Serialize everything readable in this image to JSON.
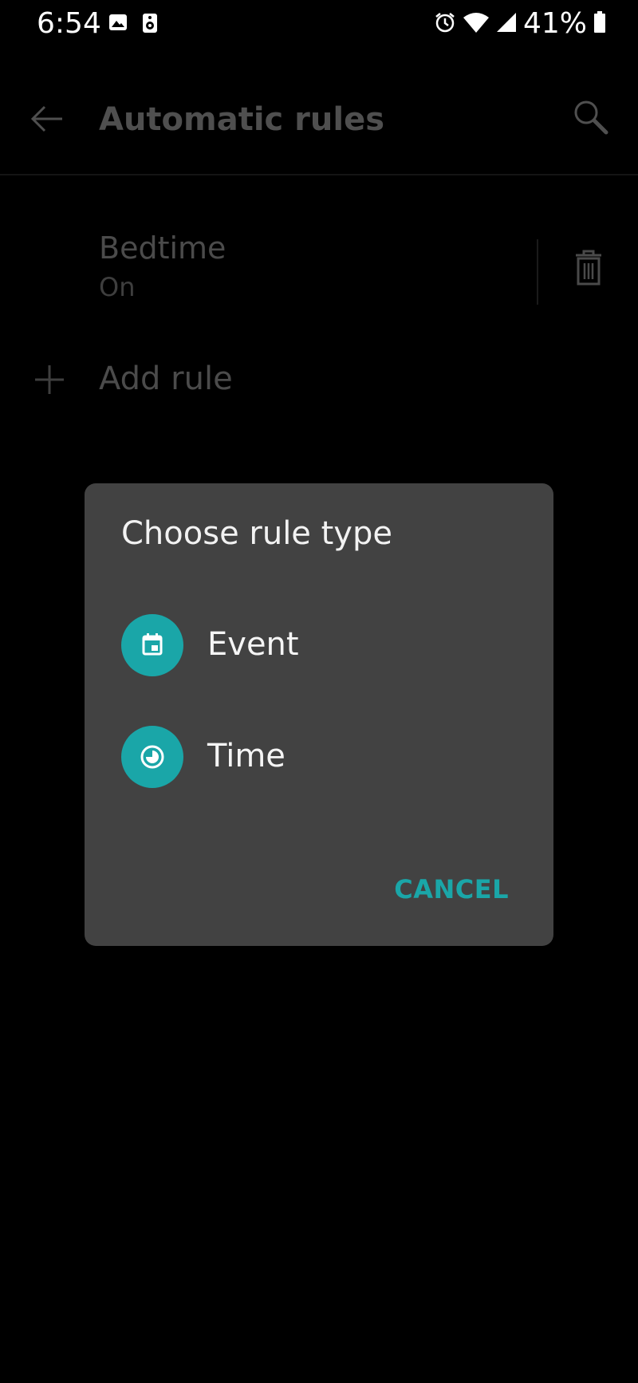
{
  "status_bar": {
    "time": "6:54",
    "battery": "41%",
    "left_icons": [
      "image-icon",
      "speaker-icon"
    ],
    "right_icons": [
      "alarm-icon",
      "wifi-icon",
      "signal-icon",
      "battery-icon"
    ]
  },
  "app_bar": {
    "title": "Automatic rules",
    "back_icon": "back-arrow-icon",
    "search_icon": "search-icon"
  },
  "rules": [
    {
      "title": "Bedtime",
      "status": "On",
      "delete_icon": "trash-icon"
    }
  ],
  "add_rule": {
    "label": "Add rule",
    "icon": "plus-icon"
  },
  "dialog": {
    "title": "Choose rule type",
    "options": [
      {
        "label": "Event",
        "icon": "calendar-icon"
      },
      {
        "label": "Time",
        "icon": "clock-icon"
      }
    ],
    "cancel_label": "CANCEL"
  },
  "colors": {
    "accent": "#1aa6a8",
    "dialog_bg": "#424242",
    "background": "#000000"
  }
}
